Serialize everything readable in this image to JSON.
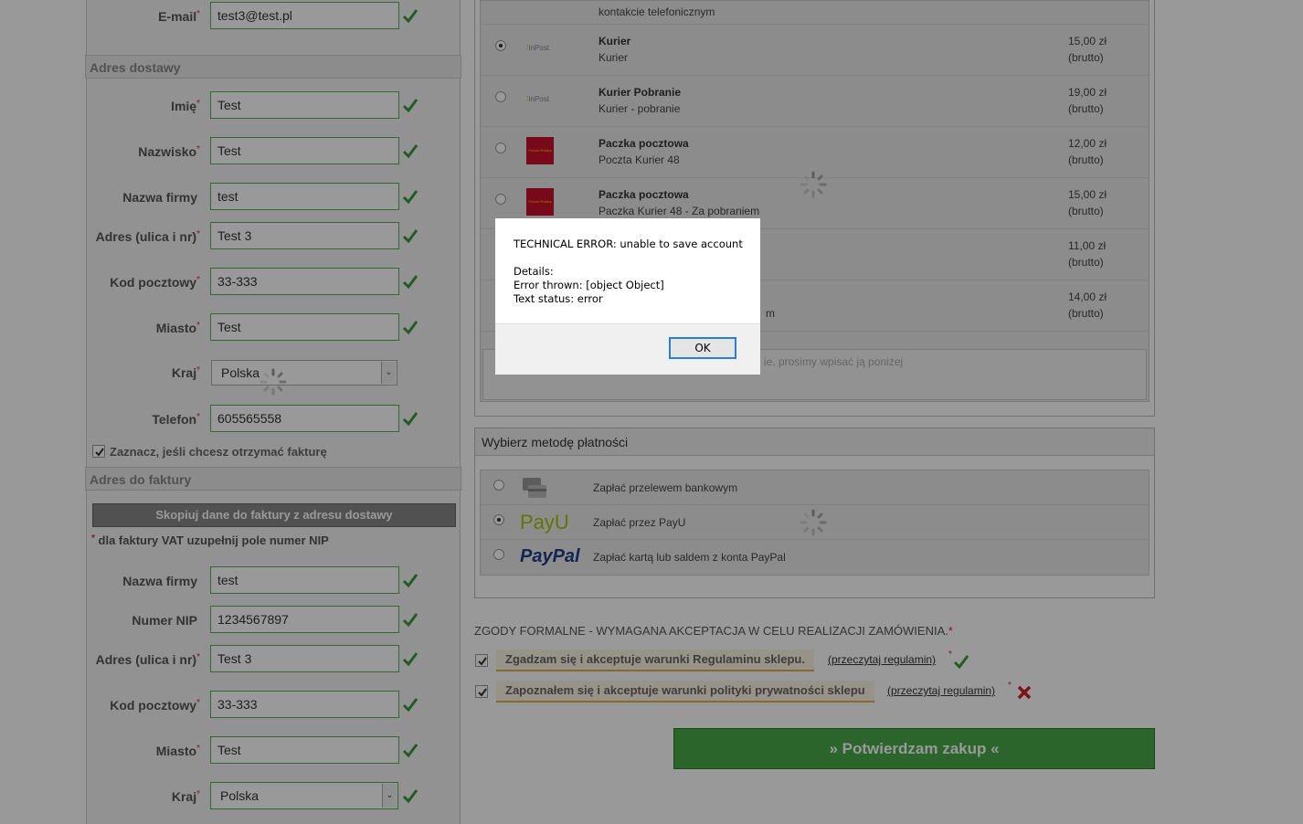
{
  "address_form": {
    "email": {
      "label": "E-mail",
      "value": "test3@test.pl"
    },
    "delivery_section": "Adres dostawy",
    "first_name": {
      "label": "Imię",
      "value": "Test"
    },
    "last_name": {
      "label": "Nazwisko",
      "value": "Test"
    },
    "company": {
      "label": "Nazwa firmy",
      "value": "test"
    },
    "street": {
      "label": "Adres (ulica i nr)",
      "value": "Test 3"
    },
    "postcode": {
      "label": "Kod pocztowy",
      "value": "33-333"
    },
    "city": {
      "label": "Miasto",
      "value": "Test"
    },
    "country": {
      "label": "Kraj",
      "value": "Polska"
    },
    "phone": {
      "label": "Telefon",
      "value": "605565558"
    },
    "invoice_checkbox": "Zaznacz, jeśli chcesz otrzymać fakturę"
  },
  "invoice_form": {
    "section": "Adres do faktury",
    "copy_button": "Skopiuj dane do faktury z adresu dostawy",
    "vat_note": "dla faktury VAT uzupełnij pole numer NIP",
    "company": {
      "label": "Nazwa firmy",
      "value": "test"
    },
    "nip": {
      "label": "Numer NIP",
      "value": "1234567897"
    },
    "street": {
      "label": "Adres (ulica i nr)",
      "value": "Test 3"
    },
    "postcode": {
      "label": "Kod pocztowy",
      "value": "33-333"
    },
    "city": {
      "label": "Miasto",
      "value": "Test"
    },
    "country": {
      "label": "Kraj",
      "value": "Polska"
    }
  },
  "shipping": {
    "top_partial_desc": "kontakcie telefonicznym",
    "rows": [
      {
        "name": "Kurier",
        "desc": "Kurier",
        "price": "15,00 zł",
        "brutto": "(brutto)",
        "logo": "InPost",
        "selected": true
      },
      {
        "name": "Kurier Pobranie",
        "desc": "Kurier - pobranie",
        "price": "19,00 zł",
        "brutto": "(brutto)",
        "logo": "InPost",
        "selected": false
      },
      {
        "name": "Paczka pocztowa",
        "desc": "Poczta Kurier 48",
        "price": "12,00 zł",
        "brutto": "(brutto)",
        "logo": "Poczta Polska",
        "selected": false
      },
      {
        "name": "Paczka pocztowa",
        "desc": "Paczka Kurier 48 - Za pobraniem",
        "price": "15,00 zł",
        "brutto": "(brutto)",
        "logo": "Poczta Polska",
        "selected": false
      },
      {
        "name": "",
        "desc": "",
        "price": "11,00 zł",
        "brutto": "(brutto)",
        "logo": "",
        "selected": false
      },
      {
        "name": "",
        "desc": "m",
        "price": "14,00 zł",
        "brutto": "(brutto)",
        "logo": "",
        "selected": false
      }
    ],
    "comment_placeholder_partial": "ie, prosimy wpisać ją poniżej"
  },
  "payment": {
    "title": "Wybierz metodę płatności",
    "rows": [
      {
        "label": "Zapłać przelewem bankowym",
        "logo": "card-icon",
        "selected": false
      },
      {
        "label": "Zapłać przez PayU",
        "logo": "PayU",
        "selected": true
      },
      {
        "label": "Zapłać kartą lub saldem z konta PayPal",
        "logo": "PayPal",
        "selected": false
      }
    ]
  },
  "consents": {
    "heading": "ZGODY FORMALNE - WYMAGANA AKCEPTACJA W CELU REALIZACJI ZAMÓWIENIA.",
    "terms": {
      "label": "Zgadzam się i akceptuje warunki Regulaminu sklepu.",
      "link": "(przeczytaj regulamin)"
    },
    "privacy": {
      "label": "Zapoznałem się i akceptuje warunki polityki prywatności sklepu",
      "link": "(przeczytaj regulamin)"
    }
  },
  "confirm_button": "» Potwierdzam zakup «",
  "dialog": {
    "line1": "TECHNICAL ERROR: unable to save account",
    "line2": "Details:",
    "line3": "Error thrown: [object Object]",
    "line4": "Text status: error",
    "ok": "OK"
  },
  "colors": {
    "accent_green": "#49a84a",
    "error_red": "#cc2222",
    "dialog_focus": "#2a7fd4"
  }
}
